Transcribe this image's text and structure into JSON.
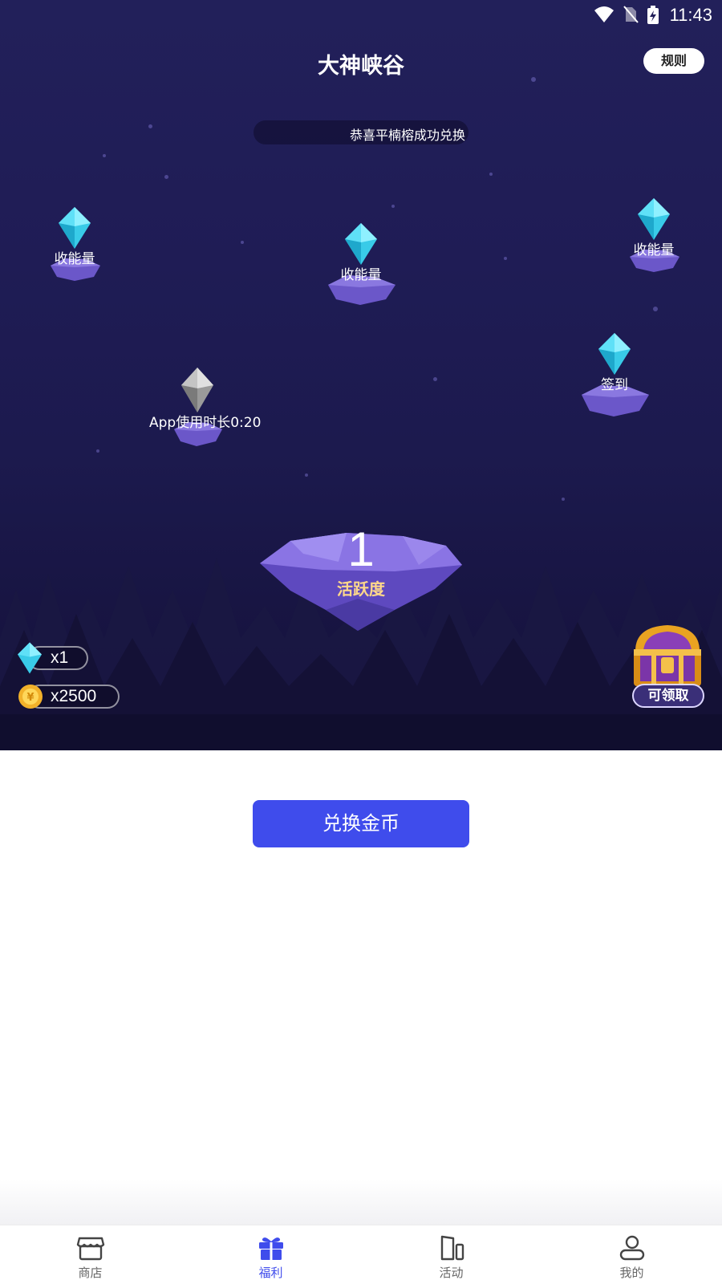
{
  "status_bar": {
    "time": "11:43",
    "icons": [
      "wifi-icon",
      "no-sim-icon",
      "battery-charging-icon"
    ]
  },
  "header": {
    "title": "大神峡谷",
    "rules_label": "规则"
  },
  "ticker": {
    "text": "恭喜平楠榕成功兑换"
  },
  "nodes": [
    {
      "label": "收能量",
      "gem": "cyan"
    },
    {
      "label": "收能量",
      "gem": "cyan"
    },
    {
      "label": "收能量",
      "gem": "cyan"
    },
    {
      "label": "签到",
      "gem": "cyan"
    },
    {
      "label": "App使用时长0:20",
      "gem": "grey"
    }
  ],
  "activity": {
    "count": "1",
    "label": "活跃度"
  },
  "wallet": {
    "diamonds": "x1",
    "coins": "x2500"
  },
  "chest": {
    "claim_label": "可领取"
  },
  "exchange": {
    "label": "兑换金币"
  },
  "nav": [
    {
      "label": "商店",
      "icon": "store-icon",
      "active": false
    },
    {
      "label": "福利",
      "icon": "gift-icon",
      "active": true
    },
    {
      "label": "活动",
      "icon": "activity-icon",
      "active": false
    },
    {
      "label": "我的",
      "icon": "profile-icon",
      "active": false
    }
  ],
  "colors": {
    "accent": "#3f4cec",
    "hero_bg": "#1f1c55",
    "gem_cyan": "#3fd6f0",
    "rock_purple": "#6a55c8",
    "active_label": "#ffd88a"
  }
}
